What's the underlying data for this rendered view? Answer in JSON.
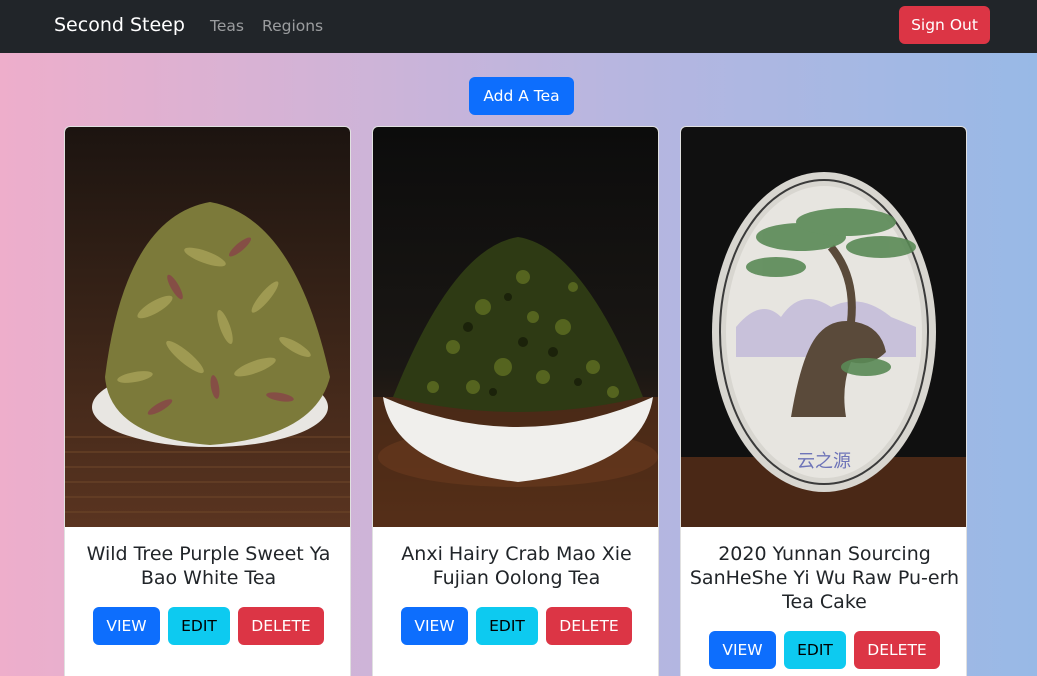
{
  "nav": {
    "brand": "Second Steep",
    "links": [
      "Teas",
      "Regions"
    ],
    "sign_out": "Sign Out"
  },
  "add_tea": "Add A Tea",
  "teas": [
    {
      "name": "Wild Tree Purple Sweet Ya Bao White Tea",
      "view": "VIEW",
      "edit": "EDIT",
      "delete": "DELETE"
    },
    {
      "name": "Anxi Hairy Crab Mao Xie Fujian Oolong Tea",
      "view": "VIEW",
      "edit": "EDIT",
      "delete": "DELETE"
    },
    {
      "name": "2020 Yunnan Sourcing SanHeShe Yi Wu Raw Pu-erh Tea Cake",
      "view": "VIEW",
      "edit": "EDIT",
      "delete": "DELETE"
    }
  ],
  "cake_stamp": "云之源",
  "colors": {
    "navbar": "#212529",
    "primary": "#0d6efd",
    "info": "#0dcaf0",
    "danger": "#dc3545"
  }
}
